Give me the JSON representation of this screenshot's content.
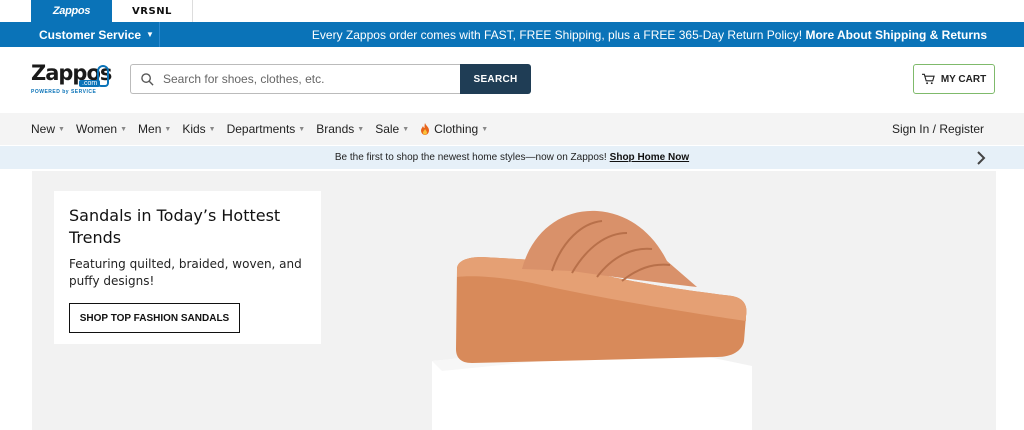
{
  "brand_tabs": [
    {
      "label": "Zappos",
      "active": true
    },
    {
      "label": "VRSNL",
      "active": false
    }
  ],
  "top_bar": {
    "customer_service": "Customer Service",
    "promo_text": "Every Zappos order comes with FAST, FREE Shipping, plus a FREE 365-Day Return Policy!",
    "promo_link": "More About Shipping & Returns",
    "color": "#0a73b8"
  },
  "header": {
    "logo_word": "Zappos",
    "logo_com": ".com",
    "logo_tagline": "POWERED by SERVICE",
    "search_placeholder": "Search for shoes, clothes, etc.",
    "search_button": "SEARCH",
    "cart_label": "MY CART"
  },
  "nav": {
    "items": [
      {
        "label": "New",
        "caret": true
      },
      {
        "label": "Women",
        "caret": true
      },
      {
        "label": "Men",
        "caret": true
      },
      {
        "label": "Kids",
        "caret": true
      },
      {
        "label": "Departments",
        "caret": true
      },
      {
        "label": "Brands",
        "caret": true
      },
      {
        "label": "Sale",
        "caret": true
      },
      {
        "label": "Clothing",
        "caret": true,
        "icon": "fire-icon"
      }
    ],
    "signin": "Sign In / Register"
  },
  "announcement": {
    "text": "Be the first to shop the newest home styles—now on Zappos!",
    "link": "Shop Home Now"
  },
  "hero": {
    "title": "Sandals in Today’s Hottest Trends",
    "subtitle": "Featuring quilted, braided, woven, and puffy designs!",
    "button": "SHOP TOP FASHION SANDALS"
  }
}
